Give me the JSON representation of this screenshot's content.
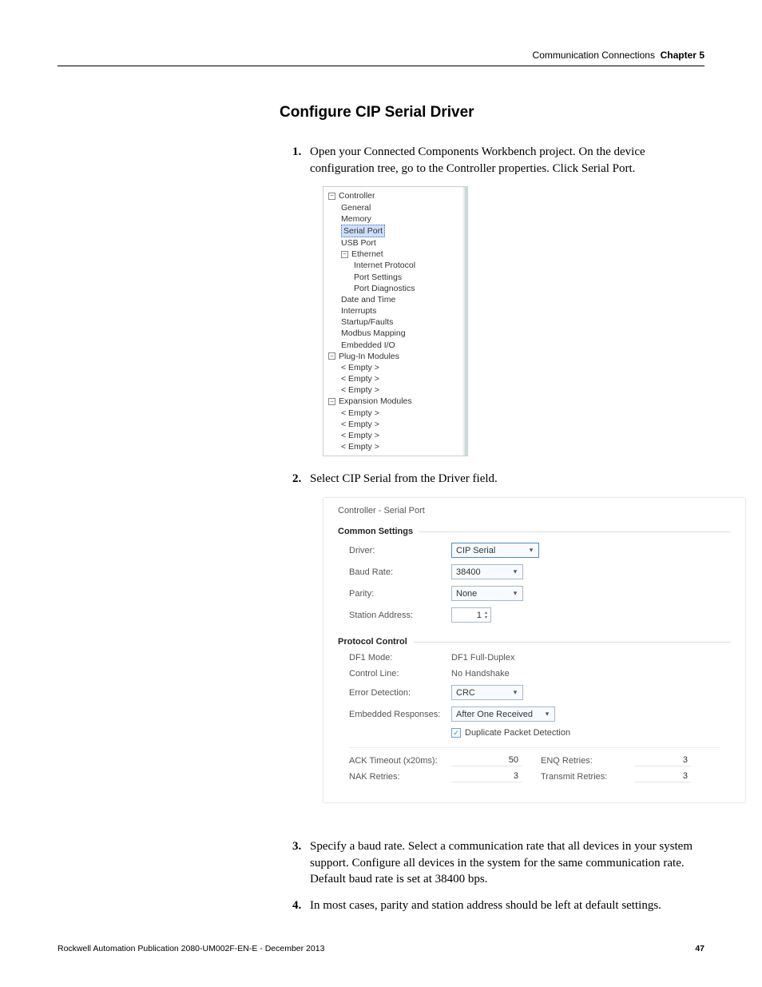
{
  "header": {
    "section": "Communication Connections",
    "chapter": "Chapter 5"
  },
  "heading": "Configure CIP Serial Driver",
  "steps": {
    "s1_num": "1.",
    "s1_text": "Open your Connected Components Workbench project. On the device configuration tree, go to the Controller properties. Click Serial Port.",
    "s2_num": "2.",
    "s2_text": "Select CIP Serial from the Driver field.",
    "s3_num": "3.",
    "s3_text": "Specify a baud rate. Select a communication rate that all devices in your system support. Configure all devices in the system for the same communication rate. Default baud rate is set at 38400 bps.",
    "s4_num": "4.",
    "s4_text": "In most cases, parity and station address should be left at default settings."
  },
  "tree": {
    "controller": "Controller",
    "general": "General",
    "memory": "Memory",
    "serial_port": "Serial Port",
    "usb_port": "USB Port",
    "ethernet": "Ethernet",
    "internet_protocol": "Internet Protocol",
    "port_settings": "Port Settings",
    "port_diagnostics": "Port Diagnostics",
    "date_and_time": "Date and Time",
    "interrupts": "Interrupts",
    "startup_faults": "Startup/Faults",
    "modbus_mapping": "Modbus Mapping",
    "embedded_io": "Embedded I/O",
    "plugin_modules": "Plug-In Modules",
    "empty": "< Empty >",
    "expansion_modules": "Expansion Modules"
  },
  "form": {
    "title": "Controller - Serial Port",
    "common_settings": "Common Settings",
    "driver_lbl": "Driver:",
    "driver_val": "CIP Serial",
    "baud_lbl": "Baud Rate:",
    "baud_val": "38400",
    "parity_lbl": "Parity:",
    "parity_val": "None",
    "station_lbl": "Station Address:",
    "station_val": "1",
    "protocol_control": "Protocol Control",
    "df1_lbl": "DF1 Mode:",
    "df1_val": "DF1 Full-Duplex",
    "ctrl_lbl": "Control Line:",
    "ctrl_val": "No Handshake",
    "err_lbl": "Error Detection:",
    "err_val": "CRC",
    "emb_lbl": "Embedded Responses:",
    "emb_val": "After One Received",
    "dup_lbl": "Duplicate Packet Detection",
    "ack_lbl": "ACK Timeout (x20ms):",
    "ack_val": "50",
    "enq_lbl": "ENQ Retries:",
    "enq_val": "3",
    "nak_lbl": "NAK Retries:",
    "nak_val": "3",
    "trans_lbl": "Transmit Retries:",
    "trans_val": "3"
  },
  "footer": {
    "pub": "Rockwell Automation Publication 2080-UM002F-EN-E - December 2013",
    "page": "47"
  },
  "glyphs": {
    "minus": "−",
    "caret": "▾",
    "up": "▴",
    "down": "▾",
    "check": "✓"
  }
}
